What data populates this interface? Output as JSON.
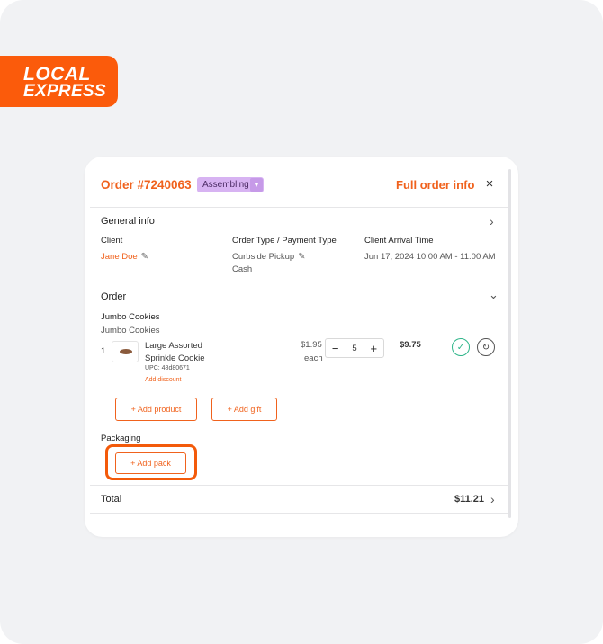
{
  "brand": {
    "line1": "LOCAL",
    "line2": "EXPRESS",
    "color": "#fb5b0b"
  },
  "header": {
    "order_title": "Order #7240063",
    "status": "Assembling",
    "full_info": "Full order info",
    "close": "×"
  },
  "general": {
    "title": "General info",
    "chevron": "›",
    "client_label": "Client",
    "client_value": "Jane Doe",
    "type_label": "Order Type / Payment Type",
    "type_value": "Curbside Pickup",
    "payment_value": "Cash",
    "arrival_label": "Client Arrival Time",
    "arrival_value": "Jun 17, 2024 10:00 AM - 11:00 AM"
  },
  "order": {
    "title": "Order",
    "chevron": "⌄",
    "category": "Jumbo Cookies",
    "subcategory": "Jumbo Cookies",
    "item": {
      "index": "1",
      "name_line1": "Large Assorted",
      "name_line2": "Sprinkle Cookie",
      "upc": "UPC: 48d80671",
      "add_discount": "Add discount",
      "price": "$1.95",
      "price_unit": "each",
      "minus": "−",
      "quantity": "5",
      "plus": "+",
      "line_total": "$9.75"
    },
    "add_product": "+ Add product",
    "add_gift": "+ Add gift"
  },
  "packaging": {
    "title": "Packaging",
    "add_pack": "+ Add pack"
  },
  "total": {
    "label": "Total",
    "value": "$11.21",
    "chevron": "›"
  },
  "colors": {
    "accent": "#f0621d",
    "status_bg": "#d7b3f2",
    "ok": "#2fb58a",
    "highlight": "#f35a0a"
  }
}
